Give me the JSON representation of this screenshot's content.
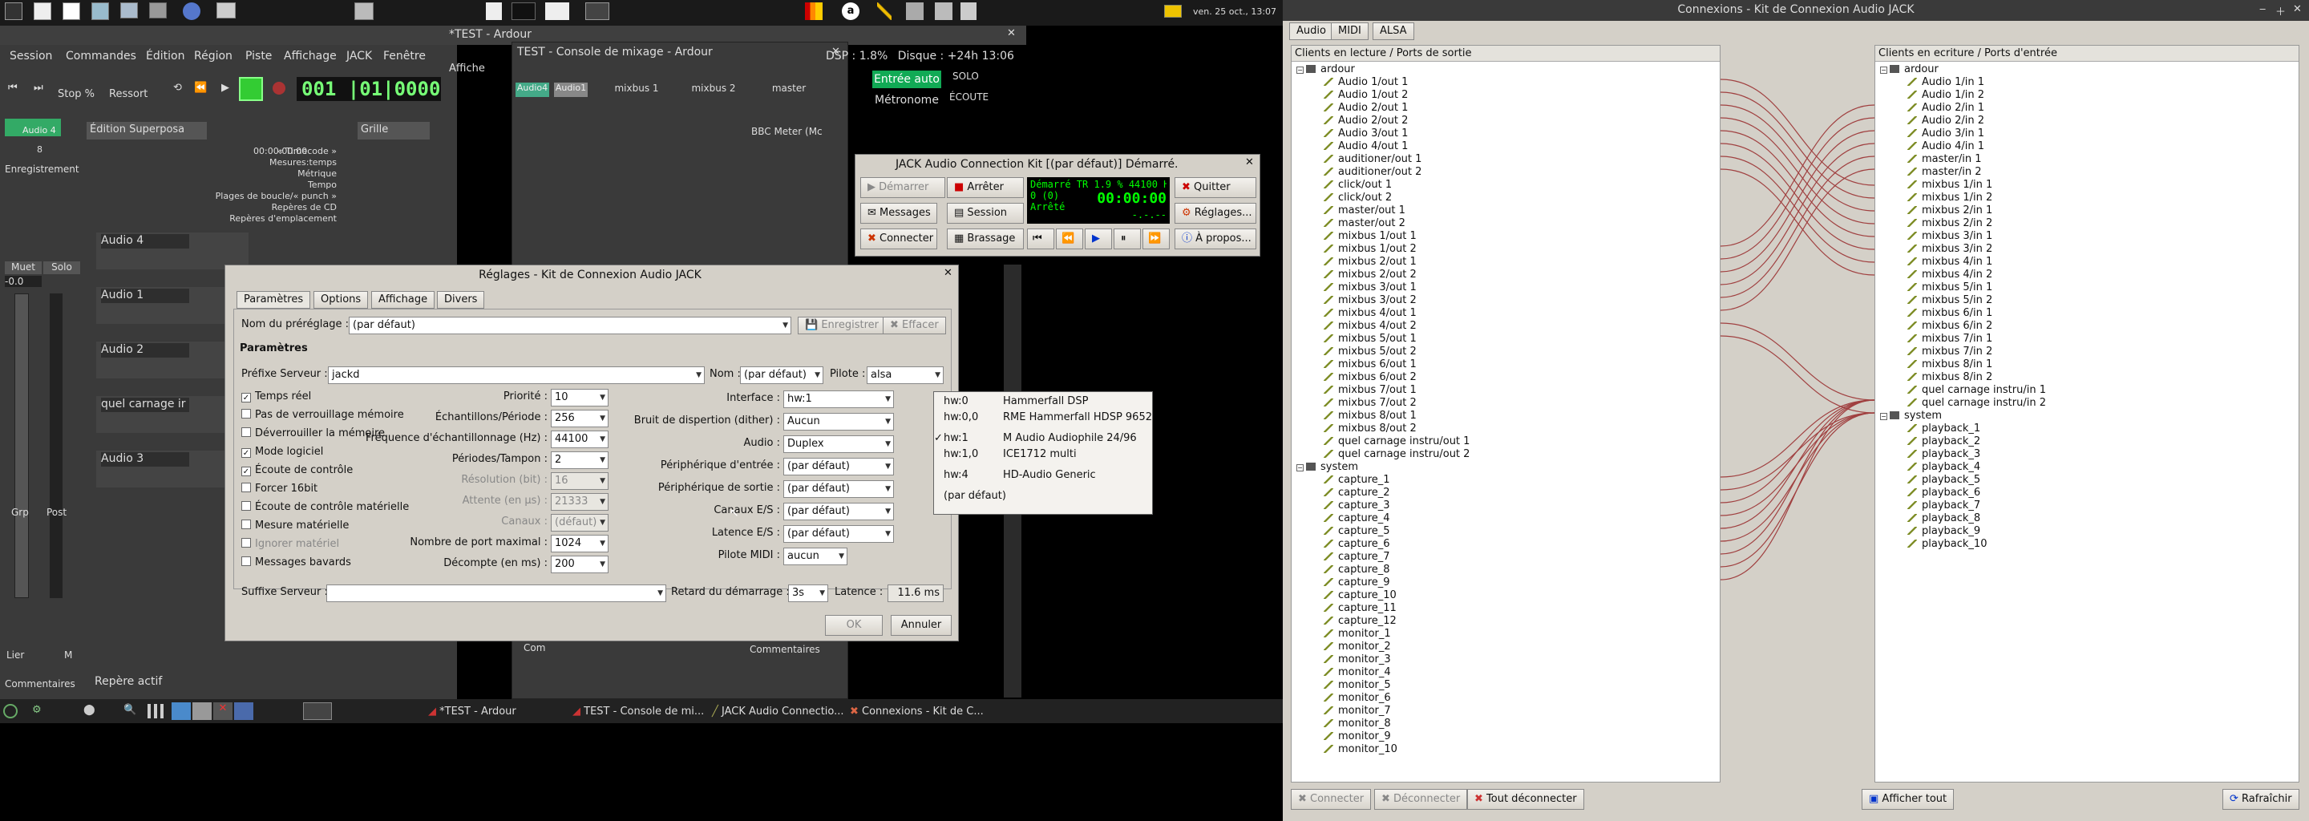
{
  "topbar": {
    "clock": "ven. 25 oct., 13:07"
  },
  "ardour": {
    "title": "*TEST - Ardour",
    "menu": [
      "Session",
      "Commandes",
      "Édition",
      "Région",
      "Piste",
      "Affichage",
      "JACK",
      "Fenêtre"
    ],
    "transport": {
      "clock": "001 |01|0000",
      "stop_mode": "Stop %",
      "ressort": "Ressort"
    },
    "status": {
      "dsp": "DSP : 1.8%",
      "disk": "Disque : +24h 13:06"
    },
    "auto_buttons": [
      "Entrée auto",
      "SOLO",
      "Métronome",
      "ÉCOUTE"
    ],
    "edit_mode": "Édition Superposa",
    "grid": "Grille",
    "rulers": [
      "« Timecode »",
      "Mesures:temps",
      "Métrique",
      "Tempo",
      "Plages de boucle/« punch »",
      "Repères de CD",
      "Repères d'emplacement"
    ],
    "timecode_value": "00:00:00:00",
    "tracks": [
      "Audio 4",
      "Audio 1",
      "Audio 2",
      "quel carnage ir",
      "Audio 3"
    ],
    "editor_mixer": {
      "name": "Audio 4",
      "record": "Enregistrement",
      "mute": "Muet",
      "solo": "Solo",
      "gain": "-0.0",
      "grp": "Grp",
      "post": "Post",
      "lier": "Lier",
      "m": "M",
      "comments": "Commentaires"
    },
    "bottom": {
      "repere": "Repère actif"
    },
    "affiche": "Affiche"
  },
  "mixer": {
    "title": "TEST - Console de mixage - Ardour",
    "strips": [
      "Audio4",
      "Audio1",
      "mixbus 1",
      "mixbus 2",
      "master"
    ],
    "bbc": "BBC Meter (Mc",
    "comments": "Commentaires",
    "com": "Com"
  },
  "qjackctl": {
    "title": "JACK Audio Connection Kit [(par défaut)] Démarré.",
    "buttons": {
      "start": "Démarrer",
      "stop": "Arrêter",
      "quit": "Quitter",
      "messages": "Messages",
      "session": "Session",
      "settings": "Réglages...",
      "connect": "Connecter",
      "patch": "Brassage",
      "about": "À propos..."
    },
    "status": {
      "line1": "Démarré TR 1.9 %  44100 Hz",
      "line2": "0 (0)",
      "time": "00:00:00",
      "state": "Arrêté",
      "misc": "-.-.--"
    }
  },
  "settings": {
    "title": "Réglages - Kit de Connexion Audio JACK",
    "tabs": [
      "Paramètres",
      "Options",
      "Affichage",
      "Divers"
    ],
    "preset_label": "Nom du préréglage :",
    "preset_value": "(par défaut)",
    "save": "Enregistrer",
    "delete": "Effacer",
    "section": "Paramètres",
    "server_prefix_label": "Préfixe Serveur :",
    "server_prefix": "jackd",
    "name_label": "Nom :",
    "name_value": "(par défaut)",
    "driver_label": "Pilote :",
    "driver_value": "alsa",
    "checks": [
      {
        "label": "Temps réel",
        "checked": true
      },
      {
        "label": "Pas de verrouillage mémoire",
        "checked": false
      },
      {
        "label": "Déverrouiller la mémoire",
        "checked": false
      },
      {
        "label": "Mode logiciel",
        "checked": true
      },
      {
        "label": "Écoute de contrôle",
        "checked": true
      },
      {
        "label": "Forcer 16bit",
        "checked": false
      },
      {
        "label": "Écoute de contrôle matérielle",
        "checked": false
      },
      {
        "label": "Mesure matérielle",
        "checked": false
      },
      {
        "label": "Ignorer matériel",
        "checked": false
      },
      {
        "label": "Messages bavards",
        "checked": false
      }
    ],
    "mid_fields": [
      {
        "label": "Priorité :",
        "value": "10"
      },
      {
        "label": "Échantillons/Période :",
        "value": "256"
      },
      {
        "label": "Fréquence d'échantillonnage (Hz) :",
        "value": "44100"
      },
      {
        "label": "Périodes/Tampon :",
        "value": "2"
      },
      {
        "label": "Résolution (bit) :",
        "value": "16"
      },
      {
        "label": "Attente (en µs) :",
        "value": "21333"
      },
      {
        "label": "Canaux :",
        "value": "(défaut)"
      },
      {
        "label": "Nombre de port maximal :",
        "value": "1024"
      },
      {
        "label": "Décompte (en ms) :",
        "value": "200"
      }
    ],
    "right_fields": [
      {
        "label": "Interface :",
        "value": "hw:1"
      },
      {
        "label": "Bruit de dispertion (dither) :",
        "value": "Aucun"
      },
      {
        "label": "Audio :",
        "value": "Duplex"
      },
      {
        "label": "Périphérique d'entrée :",
        "value": "(par défaut)"
      },
      {
        "label": "Périphérique de sortie :",
        "value": "(par défaut)"
      },
      {
        "label": "Canaux E/S :",
        "value": "(par défaut)"
      },
      {
        "label": "Latence E/S :",
        "value": "(par défaut)"
      },
      {
        "label": "Pilote MIDI :",
        "value": "aucun"
      }
    ],
    "suffix_label": "Suffixe Serveur :",
    "delay_label": "Retard du démarrage :",
    "delay_value": "3s",
    "latency_label": "Latence :",
    "latency_value": "11.6 ms",
    "ok": "OK",
    "cancel": "Annuler",
    "popup": [
      {
        "dev": "hw:0",
        "name": "Hammerfall DSP"
      },
      {
        "dev": "hw:0,0",
        "name": "RME Hammerfall HDSP 9652"
      },
      {
        "dev": "hw:1",
        "name": "M Audio Audiophile 24/96",
        "selected": true
      },
      {
        "dev": "hw:1,0",
        "name": "ICE1712 multi"
      },
      {
        "dev": "hw:4",
        "name": "HD-Audio Generic"
      },
      {
        "dev": "",
        "name": "(par défaut)"
      }
    ]
  },
  "connections": {
    "title": "Connexions - Kit de Connexion Audio JACK",
    "tabs": [
      "Audio",
      "MIDI",
      "ALSA"
    ],
    "left_header": "Clients en lecture / Ports de sortie",
    "right_header": "Clients en ecriture / Ports d'entrée",
    "left_groups": [
      {
        "name": "ardour",
        "ports": [
          "Audio 1/out 1",
          "Audio 1/out 2",
          "Audio 2/out 1",
          "Audio 2/out 2",
          "Audio 3/out 1",
          "Audio 4/out 1",
          "auditioner/out 1",
          "auditioner/out 2",
          "click/out 1",
          "click/out 2",
          "master/out 1",
          "master/out 2",
          "mixbus 1/out 1",
          "mixbus 1/out 2",
          "mixbus 2/out 1",
          "mixbus 2/out 2",
          "mixbus 3/out 1",
          "mixbus 3/out 2",
          "mixbus 4/out 1",
          "mixbus 4/out 2",
          "mixbus 5/out 1",
          "mixbus 5/out 2",
          "mixbus 6/out 1",
          "mixbus 6/out 2",
          "mixbus 7/out 1",
          "mixbus 7/out 2",
          "mixbus 8/out 1",
          "mixbus 8/out 2",
          "quel carnage instru/out 1",
          "quel carnage instru/out 2"
        ]
      },
      {
        "name": "system",
        "ports": [
          "capture_1",
          "capture_2",
          "capture_3",
          "capture_4",
          "capture_5",
          "capture_6",
          "capture_7",
          "capture_8",
          "capture_9",
          "capture_10",
          "capture_11",
          "capture_12",
          "monitor_1",
          "monitor_2",
          "monitor_3",
          "monitor_4",
          "monitor_5",
          "monitor_6",
          "monitor_7",
          "monitor_8",
          "monitor_9",
          "monitor_10"
        ]
      }
    ],
    "right_groups": [
      {
        "name": "ardour",
        "ports": [
          "Audio 1/in 1",
          "Audio 1/in 2",
          "Audio 2/in 1",
          "Audio 2/in 2",
          "Audio 3/in 1",
          "Audio 4/in 1",
          "master/in 1",
          "master/in 2",
          "mixbus 1/in 1",
          "mixbus 1/in 2",
          "mixbus 2/in 1",
          "mixbus 2/in 2",
          "mixbus 3/in 1",
          "mixbus 3/in 2",
          "mixbus 4/in 1",
          "mixbus 4/in 2",
          "mixbus 5/in 1",
          "mixbus 5/in 2",
          "mixbus 6/in 1",
          "mixbus 6/in 2",
          "mixbus 7/in 1",
          "mixbus 7/in 2",
          "mixbus 8/in 1",
          "mixbus 8/in 2",
          "quel carnage instru/in 1",
          "quel carnage instru/in 2"
        ]
      },
      {
        "name": "system",
        "ports": [
          "playback_1",
          "playback_2",
          "playback_3",
          "playback_4",
          "playback_5",
          "playback_6",
          "playback_7",
          "playback_8",
          "playback_9",
          "playback_10"
        ]
      }
    ],
    "buttons": {
      "connect": "Connecter",
      "disconnect": "Déconnecter",
      "disconnect_all": "Tout déconnecter",
      "show_all": "Afficher tout",
      "refresh": "Rafraîchir"
    }
  },
  "taskbar": {
    "items": [
      "*TEST - Ardour",
      "TEST - Console de mi...",
      "JACK Audio Connectio...",
      "Connexions - Kit de C..."
    ]
  }
}
